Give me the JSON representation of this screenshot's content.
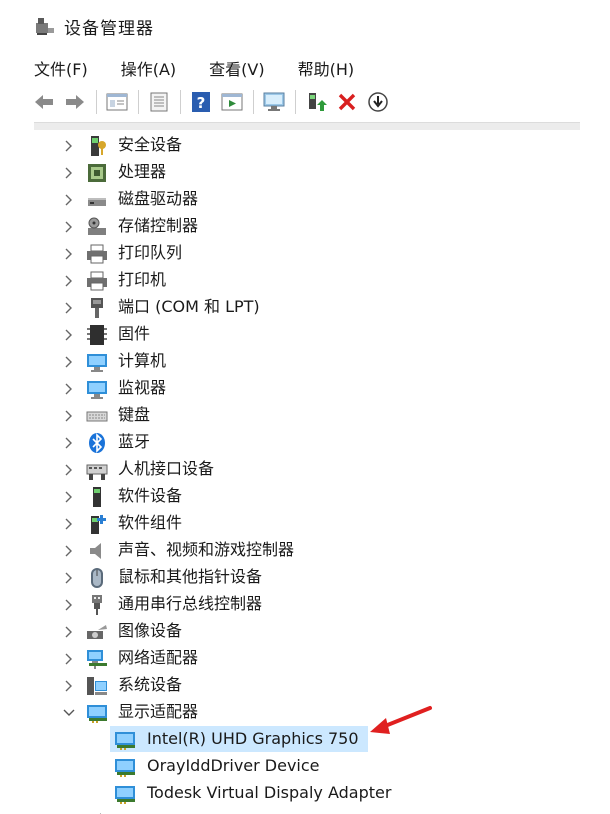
{
  "window": {
    "title": "设备管理器",
    "icon": "device-manager-icon"
  },
  "menu": [
    {
      "label": "文件(F)"
    },
    {
      "label": "操作(A)"
    },
    {
      "label": "查看(V)"
    },
    {
      "label": "帮助(H)"
    }
  ],
  "toolbar": {
    "buttons": [
      "back-icon",
      "forward-icon",
      "properties-view-icon",
      "show-hidden-icon",
      "help-icon",
      "run-view-icon",
      "scan-hardware-icon",
      "update-driver-icon",
      "uninstall-icon",
      "disable-device-icon"
    ]
  },
  "tree": {
    "categories": [
      {
        "label": "安全设备",
        "icon": "security-device-icon"
      },
      {
        "label": "处理器",
        "icon": "processor-icon"
      },
      {
        "label": "磁盘驱动器",
        "icon": "disk-drive-icon"
      },
      {
        "label": "存储控制器",
        "icon": "storage-controller-icon"
      },
      {
        "label": "打印队列",
        "icon": "print-queue-icon"
      },
      {
        "label": "打印机",
        "icon": "printer-icon"
      },
      {
        "label": "端口 (COM 和 LPT)",
        "icon": "port-icon"
      },
      {
        "label": "固件",
        "icon": "firmware-icon"
      },
      {
        "label": "计算机",
        "icon": "computer-icon"
      },
      {
        "label": "监视器",
        "icon": "monitor-icon"
      },
      {
        "label": "键盘",
        "icon": "keyboard-icon"
      },
      {
        "label": "蓝牙",
        "icon": "bluetooth-icon"
      },
      {
        "label": "人机接口设备",
        "icon": "hid-icon"
      },
      {
        "label": "软件设备",
        "icon": "software-device-icon"
      },
      {
        "label": "软件组件",
        "icon": "software-component-icon"
      },
      {
        "label": "声音、视频和游戏控制器",
        "icon": "audio-icon"
      },
      {
        "label": "鼠标和其他指针设备",
        "icon": "mouse-icon"
      },
      {
        "label": "通用串行总线控制器",
        "icon": "usb-icon"
      },
      {
        "label": "图像设备",
        "icon": "camera-icon"
      },
      {
        "label": "网络适配器",
        "icon": "network-adapter-icon"
      },
      {
        "label": "系统设备",
        "icon": "system-device-icon"
      },
      {
        "label": "显示适配器",
        "icon": "display-adapter-icon",
        "expanded": true
      }
    ],
    "display_adapters": [
      {
        "label": "Intel(R) UHD Graphics 750",
        "selected": true
      },
      {
        "label": "OrayIddDriver Device"
      },
      {
        "label": "Todesk Virtual Dispaly Adapter"
      }
    ]
  },
  "annotation": {
    "arrow_color": "#e02020"
  }
}
